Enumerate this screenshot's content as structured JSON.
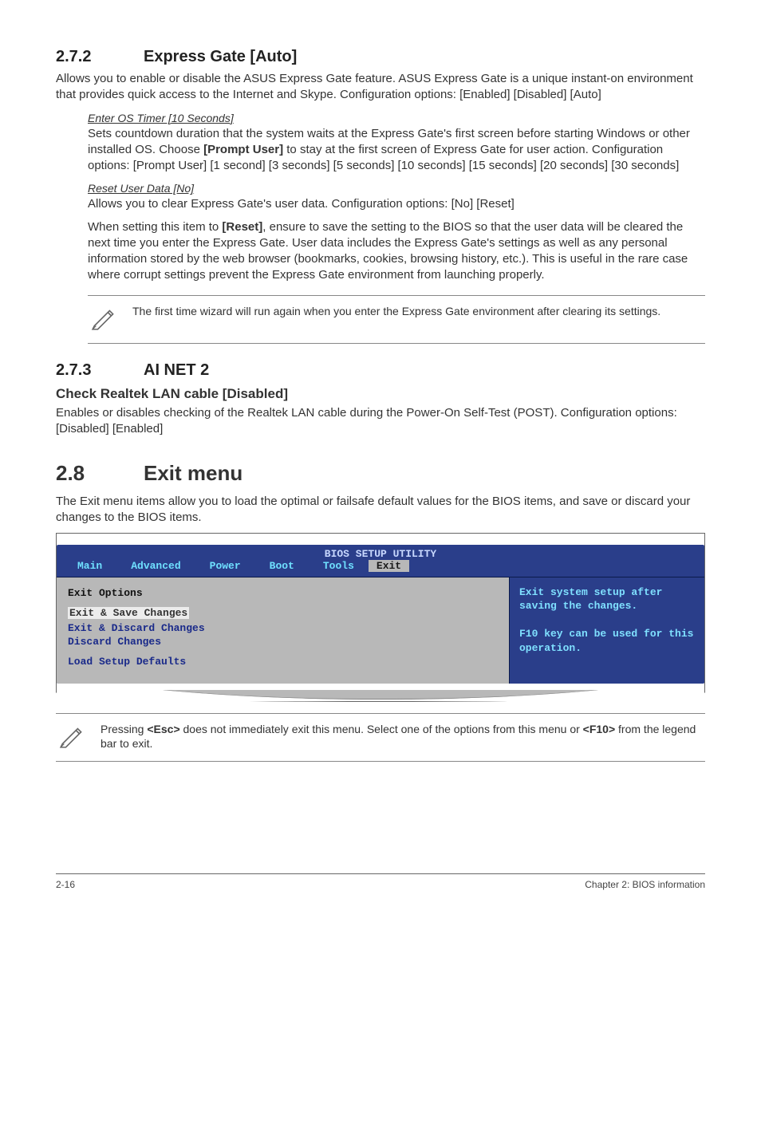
{
  "section272": {
    "number": "2.7.2",
    "title": "Express Gate [Auto]",
    "intro": "Allows you to enable or disable the ASUS Express Gate feature. ASUS Express Gate is a unique instant-on environment that provides quick access to the Internet and Skype. Configuration options: [Enabled] [Disabled] [Auto]",
    "timer_heading": "Enter OS Timer [10 Seconds]",
    "timer_text_1": "Sets countdown duration that the system waits at the Express Gate's first screen before starting Windows or other installed OS. Choose ",
    "timer_bold_1": "[Prompt User]",
    "timer_text_2": " to stay at the first screen of Express Gate for user action. Configuration options: [Prompt User] [1 second] [3 seconds] [5 seconds] [10 seconds] [15 seconds] [20 seconds] [30 seconds]",
    "reset_heading": "Reset User Data [No]",
    "reset_text_1": "Allows you to clear Express Gate's user data. Configuration options: [No] [Reset]",
    "reset_text_2a": "When setting this item to ",
    "reset_bold": "[Reset]",
    "reset_text_2b": ", ensure to save the setting to the BIOS so that the user data will be cleared the next time you enter the Express Gate. User data includes the Express Gate's settings as well as any personal information stored by the web browser (bookmarks, cookies, browsing history, etc.). This is useful in the rare case where corrupt settings prevent the Express Gate environment from launching properly.",
    "note": "The first time wizard will run again when you enter the Express Gate environment after clearing its settings."
  },
  "section273": {
    "number": "2.7.3",
    "title": "AI NET 2",
    "sub_title": "Check Realtek LAN cable [Disabled]",
    "text": "Enables or disables checking of the Realtek LAN cable during the Power-On Self-Test (POST). Configuration options: [Disabled] [Enabled]"
  },
  "section28": {
    "number": "2.8",
    "title": "Exit menu",
    "intro": "The Exit menu items allow you to load the optimal or failsafe default values for the BIOS items, and save or discard your changes to the BIOS items."
  },
  "bios": {
    "title": "BIOS SETUP UTILITY",
    "tabs": [
      "Main",
      "Advanced",
      "Power",
      "Boot",
      "Tools",
      "Exit"
    ],
    "heading": "Exit Options",
    "items": [
      "Exit & Save Changes",
      "Exit & Discard Changes",
      "Discard Changes",
      "Load Setup Defaults"
    ],
    "side_text": "Exit system setup after saving the changes.\n\nF10 key can be used for this operation."
  },
  "note2_a": "Pressing ",
  "note2_b": "<Esc>",
  "note2_c": " does not immediately exit this menu. Select one of the options from this menu or ",
  "note2_d": "<F10>",
  "note2_e": " from the legend bar to exit.",
  "footer": {
    "left": "2-16",
    "right": "Chapter 2: BIOS information"
  }
}
